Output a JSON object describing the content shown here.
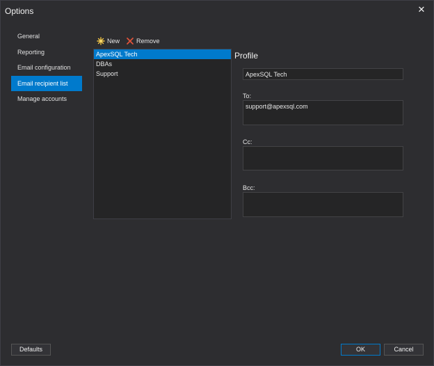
{
  "window": {
    "title": "Options",
    "close_glyph": "✕"
  },
  "sidebar": {
    "items": [
      {
        "label": "General",
        "selected": false
      },
      {
        "label": "Reporting",
        "selected": false
      },
      {
        "label": "Email configuration",
        "selected": false
      },
      {
        "label": "Email recipient list",
        "selected": true
      },
      {
        "label": "Manage accounts",
        "selected": false
      }
    ]
  },
  "toolbar": {
    "new_label": "New",
    "new_icon": "new-star-icon",
    "remove_label": "Remove",
    "remove_icon": "remove-x-icon"
  },
  "profiles": {
    "items": [
      {
        "label": "ApexSQL Tech",
        "selected": true
      },
      {
        "label": "DBAs",
        "selected": false
      },
      {
        "label": "Support",
        "selected": false
      }
    ]
  },
  "profile": {
    "heading": "Profile",
    "name_value": "ApexSQL Tech",
    "to_label": "To:",
    "to_value": "support@apexsql.com",
    "cc_label": "Cc:",
    "cc_value": "",
    "bcc_label": "Bcc:",
    "bcc_value": ""
  },
  "footer": {
    "defaults_label": "Defaults",
    "ok_label": "OK",
    "cancel_label": "Cancel"
  },
  "colors": {
    "background": "#2d2d30",
    "accent": "#007acc",
    "panel": "#252526"
  }
}
